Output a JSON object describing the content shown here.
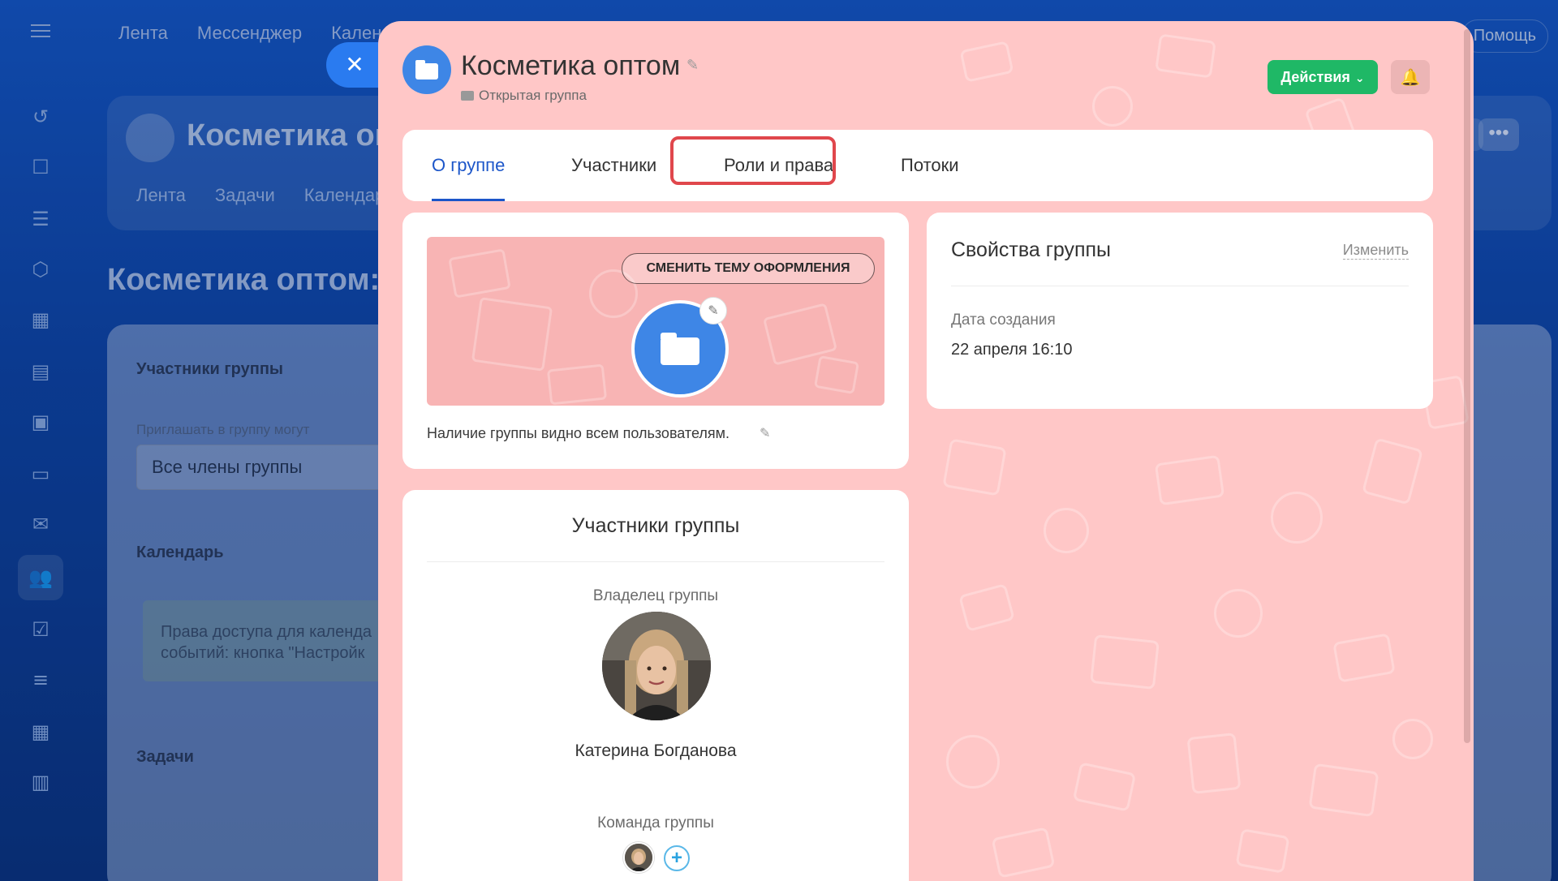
{
  "background": {
    "top_nav": [
      "Лента",
      "Мессенджер",
      "Кален"
    ],
    "help": "Помощь",
    "group_title": "Косметика оп",
    "group_tabs": [
      "Лента",
      "Задачи",
      "Календар"
    ],
    "more": "•••",
    "page_title": "Косметика оптом: Н",
    "settings": {
      "members_heading": "Участники группы",
      "invite_label": "Приглашать в группу могут",
      "invite_value": "Все члены группы",
      "calendar_heading": "Календарь",
      "calendar_note": "Права доступа для календа событий: кнопка \"Настройк",
      "tasks_heading": "Задачи"
    }
  },
  "slider": {
    "close_icon": "✕",
    "title": "Косметика оптом",
    "subtitle": "Открытая группа",
    "actions_label": "Действия",
    "tabs": {
      "about": "О группе",
      "members": "Участники",
      "roles": "Роли и права",
      "streams": "Потоки"
    },
    "about": {
      "theme_button": "СМЕНИТЬ ТЕМУ ОФОРМЛЕНИЯ",
      "visibility_text": "Наличие группы видно всем пользователям."
    },
    "properties": {
      "title": "Свойства группы",
      "edit_link": "Изменить",
      "created_label": "Дата создания",
      "created_value": "22 апреля 16:10"
    },
    "members": {
      "title": "Участники группы",
      "owner_label": "Владелец группы",
      "owner_name": "Катерина Богданова",
      "team_label": "Команда группы",
      "add_icon": "+"
    }
  },
  "colors": {
    "accent_blue": "#1c56c9",
    "actions_green": "#1fb866",
    "highlight_red": "#e0474c",
    "panel_pink": "#ffc7c7"
  }
}
